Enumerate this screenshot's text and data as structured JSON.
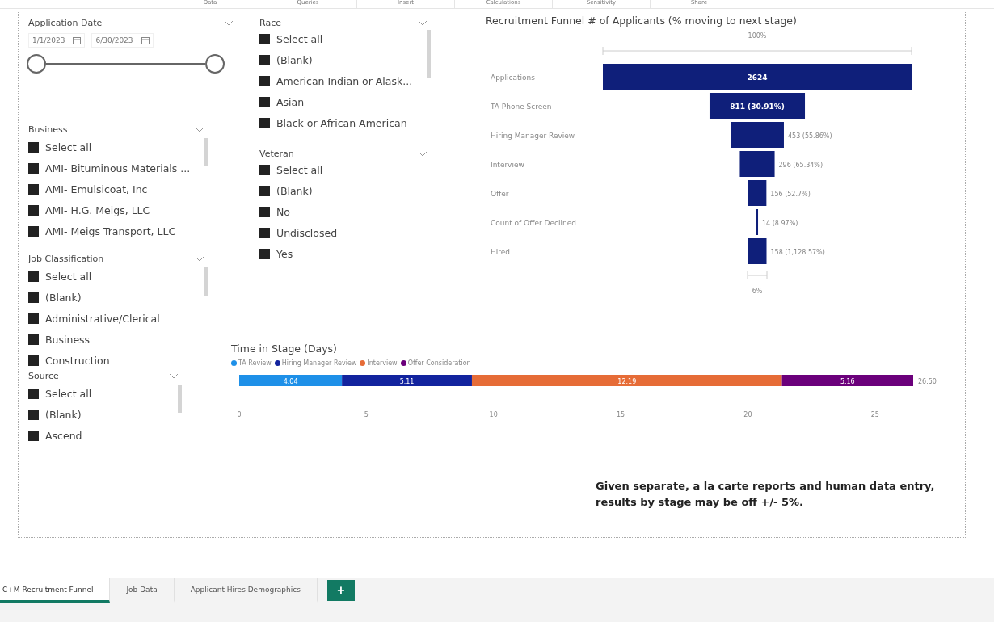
{
  "ribbon": {
    "groups": [
      "Data",
      "Queries",
      "Insert",
      "Calculations",
      "Sensitivity",
      "Share"
    ]
  },
  "date_slicer": {
    "title": "Application Date",
    "start": "1/1/2023",
    "end": "6/30/2023"
  },
  "slicers_left": [
    {
      "title": "Business",
      "items": [
        {
          "label": "Select all",
          "checked": true
        },
        {
          "label": "AMI- Bituminous Materials ...",
          "checked": true
        },
        {
          "label": "AMI- Emulsicoat, Inc",
          "checked": true
        },
        {
          "label": "AMI- H.G. Meigs, LLC",
          "checked": true
        },
        {
          "label": "AMI- Meigs Transport, LLC",
          "checked": true
        }
      ]
    },
    {
      "title": "Job Classification",
      "items": [
        {
          "label": "Select all",
          "checked": true
        },
        {
          "label": "(Blank)",
          "checked": true
        },
        {
          "label": "Administrative/Clerical",
          "checked": true
        },
        {
          "label": "Business",
          "checked": true
        },
        {
          "label": "Construction",
          "checked": true
        }
      ]
    },
    {
      "title": "Source",
      "items": [
        {
          "label": "Select all",
          "checked": true
        },
        {
          "label": "(Blank)",
          "checked": true
        },
        {
          "label": "Ascend",
          "checked": true
        }
      ]
    }
  ],
  "slicers_mid": [
    {
      "title": "Race",
      "items": [
        {
          "label": "Select all",
          "checked": true
        },
        {
          "label": "(Blank)",
          "checked": true
        },
        {
          "label": "American Indian or Alask...",
          "checked": true
        },
        {
          "label": "Asian",
          "checked": true
        },
        {
          "label": "Black or African American",
          "checked": true
        }
      ]
    },
    {
      "title": "Veteran",
      "items": [
        {
          "label": "Select all",
          "checked": true
        },
        {
          "label": "(Blank)",
          "checked": true
        },
        {
          "label": "No",
          "checked": true
        },
        {
          "label": "Undisclosed",
          "checked": true
        },
        {
          "label": "Yes",
          "checked": true
        }
      ]
    }
  ],
  "funnel": {
    "title": "Recruitment Funnel # of Applicants (% moving to next stage)",
    "top_label": "100%",
    "bottom_label": "6%",
    "stages": [
      {
        "label": "Applications",
        "value": "2624"
      },
      {
        "label": "TA Phone Screen",
        "value": "811 (30.91%)"
      },
      {
        "label": "Hiring Manager Review",
        "value": "453 (55.86%)"
      },
      {
        "label": "Interview",
        "value": "296 (65.34%)"
      },
      {
        "label": "Offer",
        "value": "156 (52.7%)"
      },
      {
        "label": "Count of Offer Declined",
        "value": "14 (8.97%)"
      },
      {
        "label": "Hired",
        "value": "158 (1,128.57%)"
      }
    ]
  },
  "time_in_stage": {
    "title": "Time in Stage (Days)",
    "total": "26.50",
    "chart_data": {
      "type": "bar",
      "orientation": "horizontal",
      "stacked": true,
      "legend": "top",
      "xticks": [
        0,
        5,
        10,
        15,
        20,
        25
      ],
      "xlim": [
        0,
        26.5
      ],
      "series": [
        {
          "name": "TA Review",
          "color": "#1e90e8",
          "values": [
            4.04
          ]
        },
        {
          "name": "Hiring Manager Review",
          "color": "#12239e",
          "values": [
            5.11
          ]
        },
        {
          "name": "Interview",
          "color": "#e66c37",
          "values": [
            12.19
          ]
        },
        {
          "name": "Offer Consideration",
          "color": "#6b007b",
          "values": [
            5.16
          ]
        }
      ],
      "value_labels": [
        "4.04",
        "5.11",
        "12.19",
        "5.16"
      ]
    }
  },
  "note": "Given separate, a la carte reports and human data entry, results by stage may be off +/- 5%.",
  "tabs": [
    {
      "label": "C+M Recruitment Funnel",
      "selected": true
    },
    {
      "label": "Job Data",
      "selected": false
    },
    {
      "label": "Applicant Hires Demographics",
      "selected": false
    }
  ],
  "add_tab": "+"
}
